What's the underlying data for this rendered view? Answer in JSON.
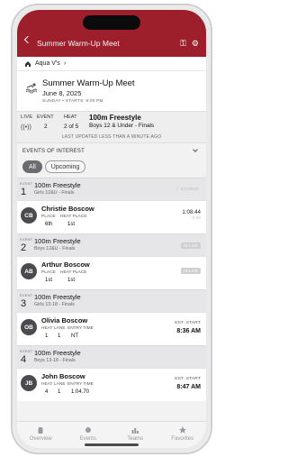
{
  "colors": {
    "brand": "#9e1f2c",
    "bg": "#f2f2f3",
    "muted": "#7a7a7d"
  },
  "nav": {
    "title": "Summer Warm-Up Meet"
  },
  "breadcrumb": {
    "team": "Aqua V's"
  },
  "meet": {
    "title": "Summer Warm-Up Meet",
    "date": "June 8, 2025",
    "details": "SUNDAY  •  STARTS: 6:00 PM"
  },
  "live": {
    "label": "LIVE",
    "event_label": "EVENT",
    "event_value": "2",
    "heat_label": "HEAT",
    "heat_value": "2 of 5",
    "race_title": "100m Freestyle",
    "race_sub": "Boys 12 & Under - Finals",
    "updated": "LAST UPDATED LESS THAN A MINUTE AGO"
  },
  "section": {
    "title": "EVENTS OF INTEREST"
  },
  "filters": {
    "all": "All",
    "upcoming": "Upcoming"
  },
  "events": [
    {
      "word": "EVENT",
      "num": "1",
      "name": "100m Freestyle",
      "meta": "Girls 12&U - Finals",
      "status": "✓ SCORED",
      "swimmer": {
        "initials": "CB",
        "name": "Christie Boscow",
        "h1": "PLACE",
        "v1": "6th",
        "h2": "HEAT PLACE",
        "v2": "1st",
        "right1": "1:08.44",
        "right2": "-3.68"
      }
    },
    {
      "word": "EVENT",
      "num": "2",
      "name": "100m Freestyle",
      "meta": "Boys 12&U - Finals",
      "badge": "IN LIVE",
      "swimmer": {
        "initials": "AB",
        "name": "Arthur Boscow",
        "h1": "PLACE",
        "v1": "1st",
        "h2": "HEAT PLACE",
        "v2": "1st",
        "badge": "IN LIVE"
      }
    },
    {
      "word": "EVENT",
      "num": "3",
      "name": "100m Freestyle",
      "meta": "Girls 13-18 - Finals",
      "swimmer": {
        "initials": "OB",
        "name": "Olivia Boscow",
        "h1": "HEAT",
        "v1": "1",
        "h2": "LANE",
        "v2": "1",
        "h3": "ENTRY TIME",
        "v3": "NT",
        "est_h": "EST. START",
        "est_v": "8:36 AM"
      }
    },
    {
      "word": "EVENT",
      "num": "4",
      "name": "100m Freestyle",
      "meta": "Boys 13-18 - Finals",
      "swimmer": {
        "initials": "JB",
        "name": "John Boscow",
        "h1": "HEAT",
        "v1": "4",
        "h2": "LANE",
        "v2": "1",
        "h3": "ENTRY TIME",
        "v3": "1:04.70",
        "est_h": "EST. START",
        "est_v": "8:47 AM"
      }
    }
  ],
  "tabs": [
    {
      "label": "Overview",
      "icon": "trash-icon"
    },
    {
      "label": "Events",
      "icon": "dot-icon"
    },
    {
      "label": "Teams",
      "icon": "bar-chart-icon"
    },
    {
      "label": "Favorites",
      "icon": "star-icon"
    }
  ]
}
